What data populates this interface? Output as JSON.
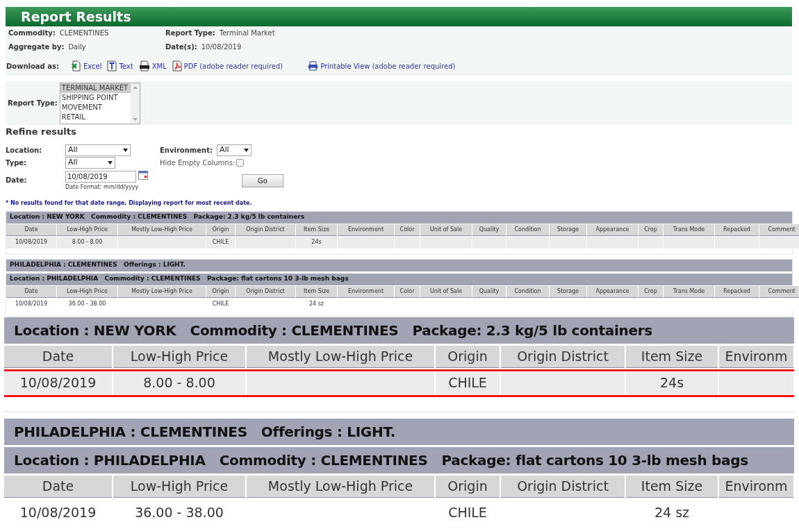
{
  "title": "Report Results",
  "summary": [
    {
      "label": "Commodity:",
      "value": "CLEMENTINES"
    },
    {
      "label": "Report Type:",
      "value": "Terminal Market"
    },
    {
      "label": "Aggregate by:",
      "value": "Daily"
    },
    {
      "label": "Date(s):",
      "value": "10/08/2019"
    }
  ],
  "download": {
    "label": "Download as:",
    "links": [
      {
        "kind": "excel",
        "label": "Excel"
      },
      {
        "kind": "text",
        "label": "Text"
      },
      {
        "kind": "xml",
        "label": "XML"
      },
      {
        "kind": "pdf",
        "label": "PDF",
        "note": "(adobe reader required)"
      },
      {
        "kind": "print",
        "label": "Printable View",
        "note": "(adobe reader required)"
      }
    ]
  },
  "report_type": {
    "label": "Report Type:",
    "options": [
      {
        "label": "TERMINAL MARKET",
        "selected": true
      },
      {
        "label": "SHIPPING POINT",
        "selected": false
      },
      {
        "label": "MOVEMENT",
        "selected": false
      },
      {
        "label": "RETAIL",
        "selected": false
      }
    ]
  },
  "refine": {
    "title": "Refine results",
    "location": {
      "label": "Location:",
      "value": "All"
    },
    "type": {
      "label": "Type:",
      "value": "All"
    },
    "date": {
      "label": "Date:",
      "value": "10/08/2019",
      "hint": "Date Format: mm/dd/yyyy"
    },
    "environment": {
      "label": "Environment:",
      "value": "All"
    },
    "hide_empty": {
      "label": "Hide Empty Columns:",
      "checked": false
    },
    "go": "Go"
  },
  "notice": "* No results found for that date range. Displaying report for most recent date.",
  "reports": [
    {
      "heading": "Location : NEW YORK   Commodity : CLEMENTINES   Package: 2.3 kg/5 lb containers",
      "columns": [
        "Date",
        "Low-High Price",
        "Mostly Low-High Price",
        "Origin",
        "Origin District",
        "Item Size",
        "Environment",
        "Color",
        "Unit of Sale",
        "Quality",
        "Condition",
        "Storage",
        "Appearance",
        "Crop",
        "Trans Mode",
        "Repacked",
        "Comment"
      ],
      "rows": [
        {
          "cells": [
            "10/08/2019",
            "8.00 - 8.00",
            null,
            "CHILE",
            null,
            "24s",
            null,
            null,
            null,
            null,
            null,
            null,
            null,
            null,
            null,
            null,
            null
          ]
        }
      ]
    },
    {
      "banner": "PHILADELPHIA : CLEMENTINES   Offerings : LIGHT.",
      "heading": "Location : PHILADELPHIA   Commodity : CLEMENTINES   Package: flat cartons 10 3-lb mesh bags",
      "columns": [
        "Date",
        "Low-High Price",
        "Mostly Low-High Price",
        "Origin",
        "Origin District",
        "Item Size",
        "Environment",
        "Color",
        "Unit of Sale",
        "Quality",
        "Condition",
        "Storage",
        "Appearance",
        "Crop",
        "Trans Mode",
        "Repacked",
        "Comment"
      ],
      "rows": [
        {
          "cells": [
            "10/08/2019",
            "36.00 - 38.00",
            null,
            "CHILE",
            null,
            "24 sz",
            null,
            null,
            null,
            null,
            null,
            null,
            null,
            null,
            null,
            null,
            null
          ]
        }
      ]
    }
  ],
  "zoom_inset": {
    "reports": [
      {
        "heading": "Location : NEW YORK   Commodity : CLEMENTINES   Package: 2.3 kg/5 lb containers",
        "columns": [
          "Date",
          "Low-High Price",
          "Mostly Low-High Price",
          "Origin",
          "Origin District",
          "Item Size",
          "Environm"
        ],
        "rows": [
          {
            "highlighted": true,
            "cells": [
              "10/08/2019",
              "8.00 - 8.00",
              null,
              "CHILE",
              null,
              "24s",
              null
            ]
          }
        ]
      },
      {
        "banner": "PHILADELPHIA : CLEMENTINES   Offerings : LIGHT.",
        "heading": "Location : PHILADELPHIA   Commodity : CLEMENTINES   Package: flat cartons 10 3-lb mesh bags",
        "columns": [
          "Date",
          "Low-High Price",
          "Mostly Low-High Price",
          "Origin",
          "Origin District",
          "Item Size",
          "Environm"
        ],
        "rows": [
          {
            "highlighted": false,
            "cells": [
              "10/08/2019",
              "36.00 - 38.00",
              null,
              "CHILE",
              null,
              "24 sz",
              null
            ]
          }
        ]
      }
    ]
  }
}
